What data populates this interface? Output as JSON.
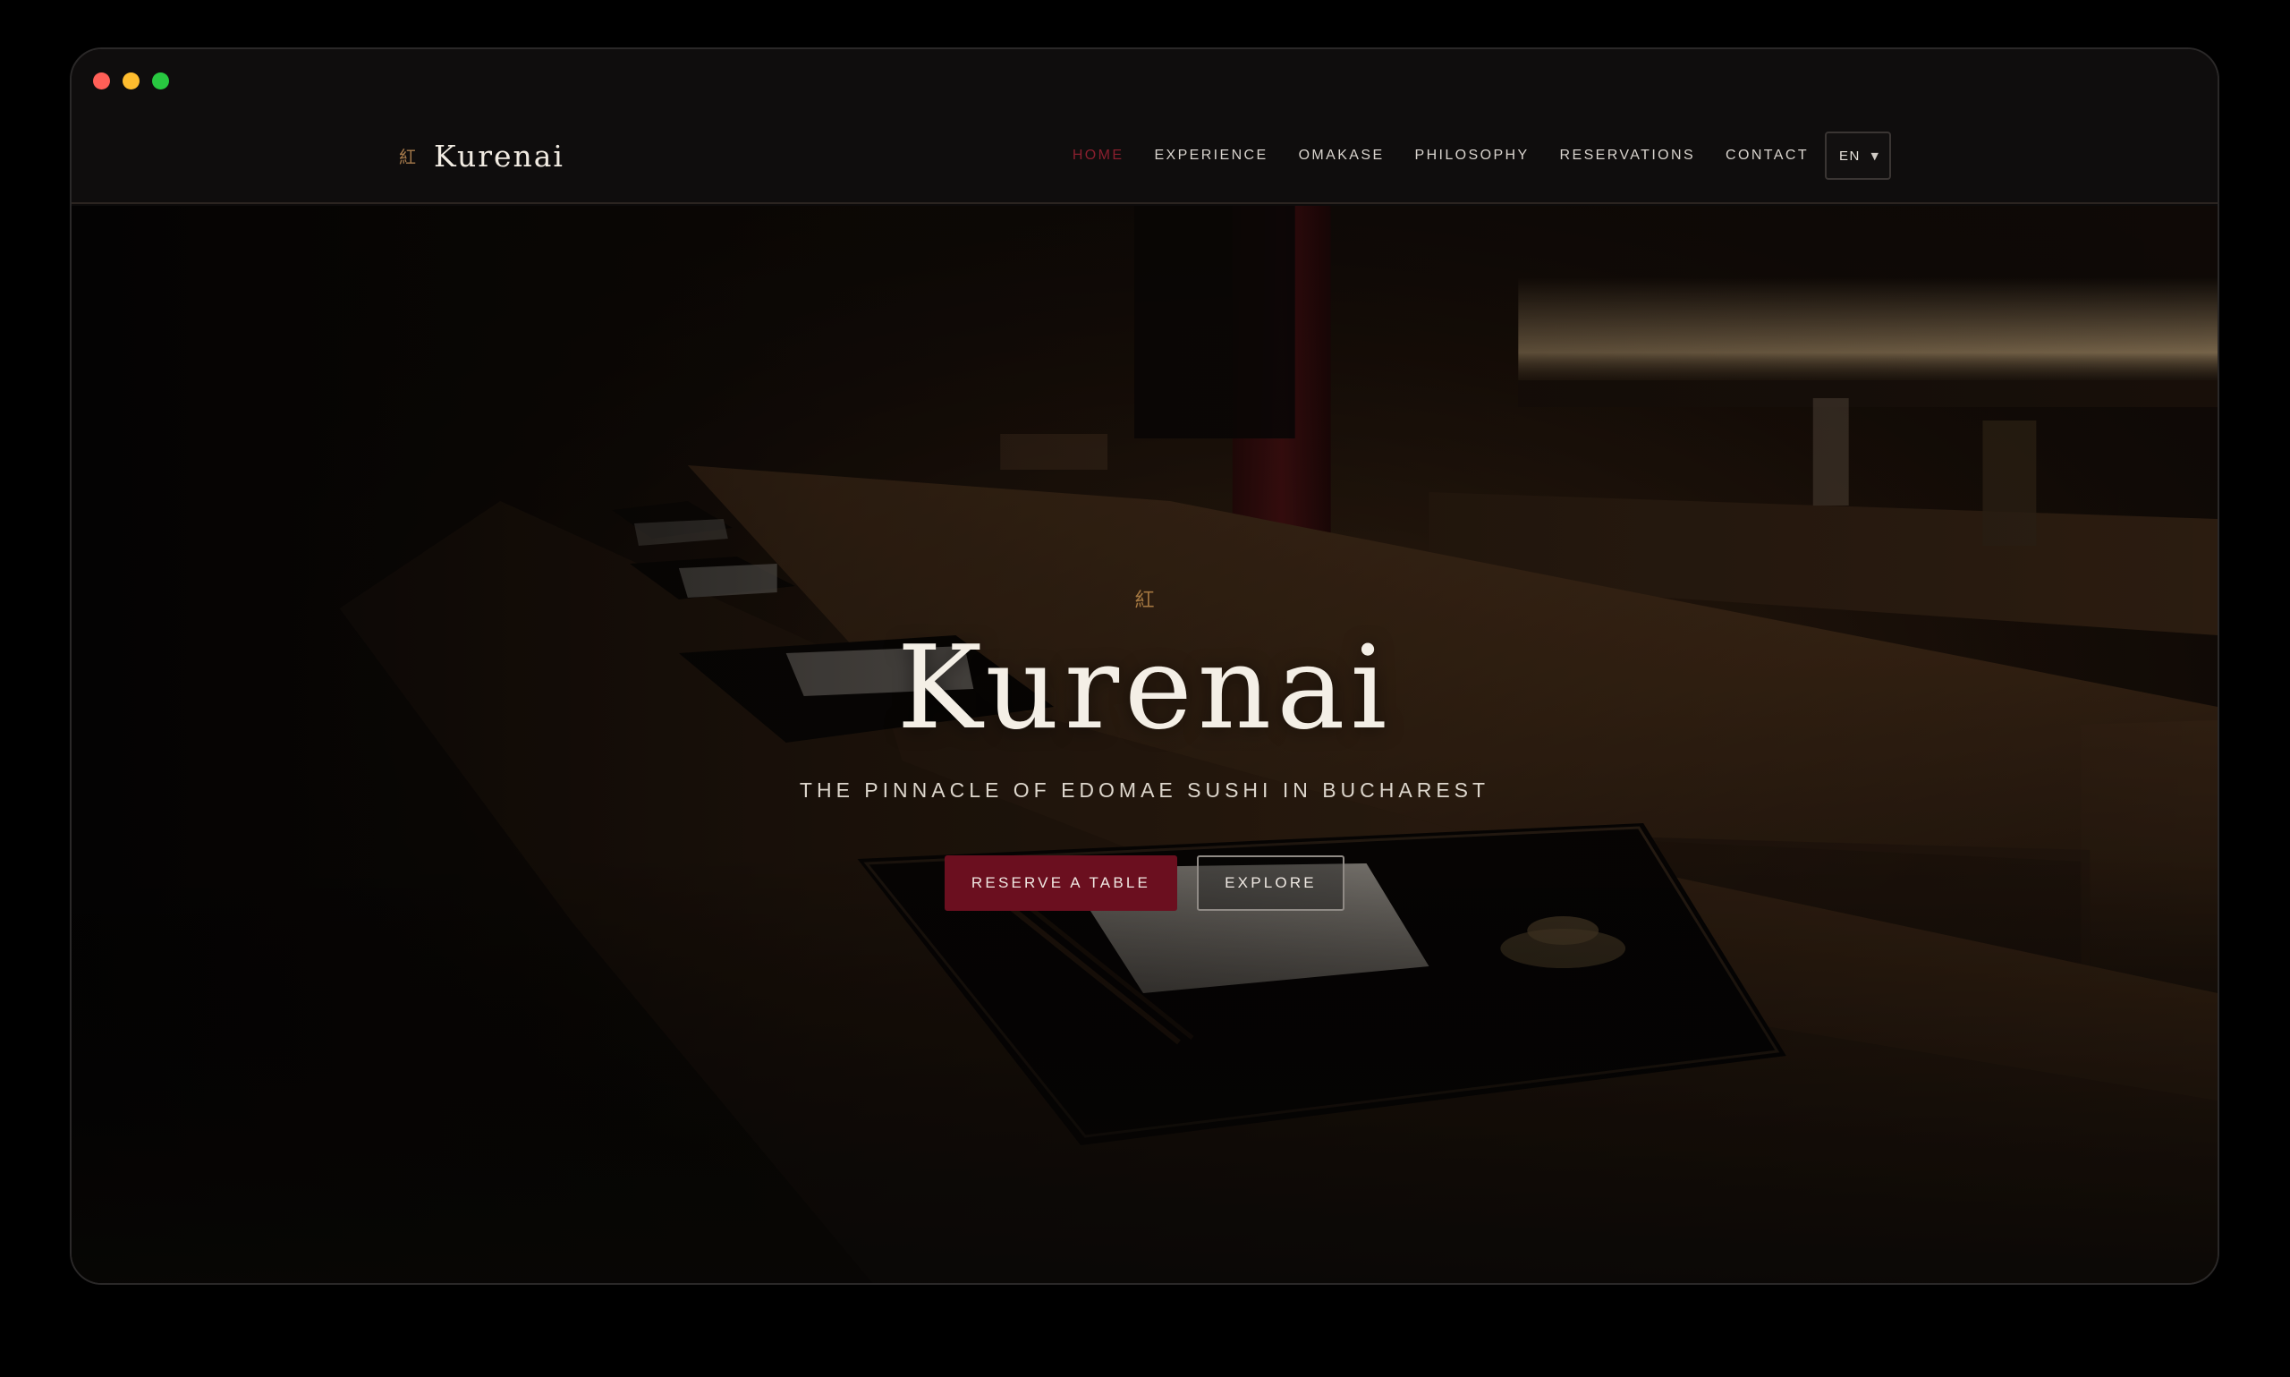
{
  "window": {
    "controls": [
      "close",
      "minimize",
      "maximize"
    ]
  },
  "brand": {
    "kanji": "紅",
    "name": "Kurenai"
  },
  "nav": {
    "items": [
      {
        "label": "HOME",
        "active": true
      },
      {
        "label": "EXPERIENCE",
        "active": false
      },
      {
        "label": "OMAKASE",
        "active": false
      },
      {
        "label": "PHILOSOPHY",
        "active": false
      },
      {
        "label": "RESERVATIONS",
        "active": false
      },
      {
        "label": "CONTACT",
        "active": false
      }
    ],
    "language": {
      "value": "EN",
      "icon": "chevron-down-icon"
    }
  },
  "hero": {
    "kanji": "紅",
    "title": "Kurenai",
    "tagline": "THE PINNACLE OF EDOMAE SUSHI IN BUCHAREST",
    "primary_button": "RESERVE A TABLE",
    "secondary_button": "EXPLORE",
    "background": "dimly lit wooden sushi counter with black lacquer trays, folded napkins and chopsticks"
  },
  "colors": {
    "accent": "#6b0f1f",
    "active_nav": "#8a1f2e",
    "gold": "#a67a4b",
    "background": "#0d0b0b"
  }
}
